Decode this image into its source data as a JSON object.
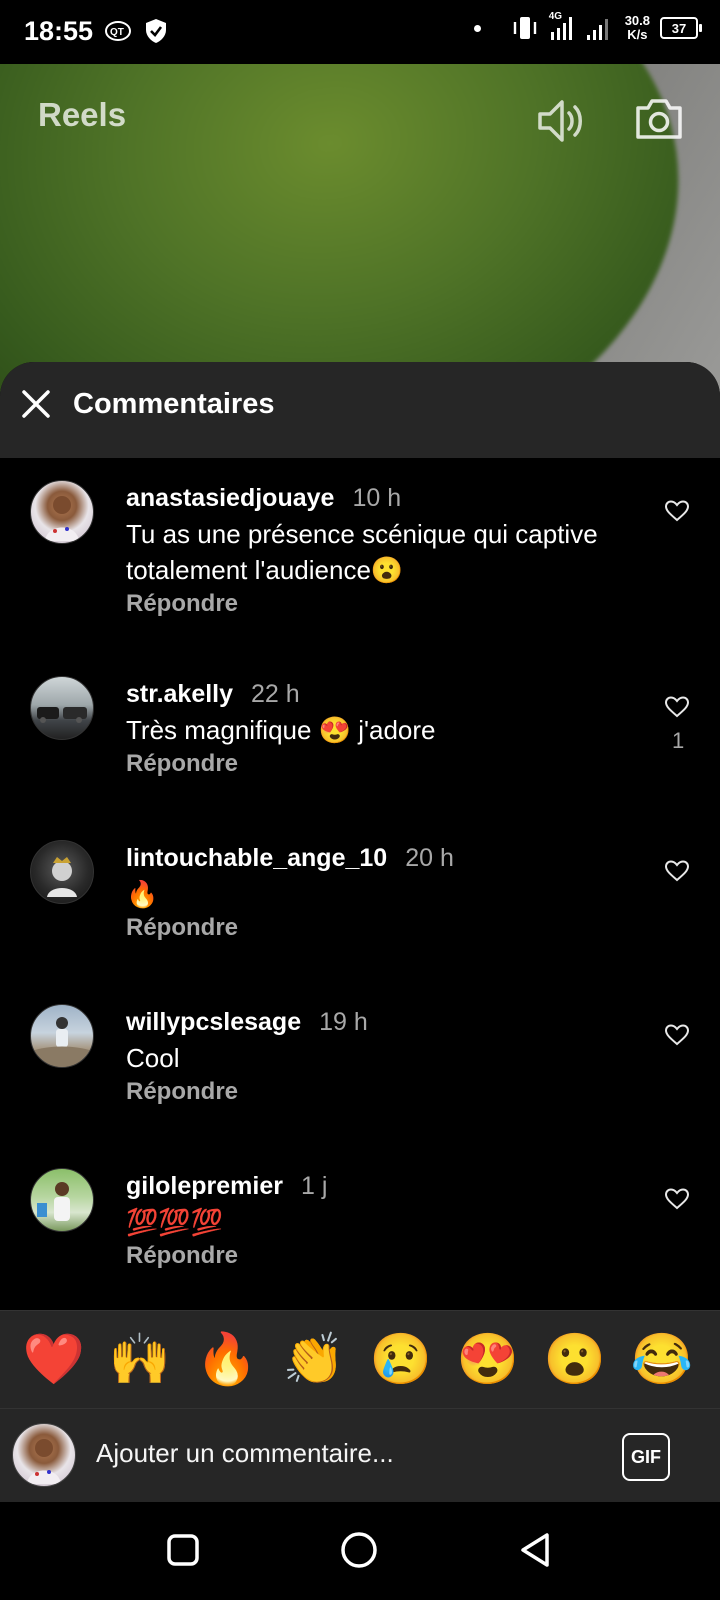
{
  "status_bar": {
    "time": "18:55",
    "network": "4G",
    "speed_value": "30.8",
    "speed_unit": "K/s",
    "battery": "37"
  },
  "video": {
    "title": "Reels"
  },
  "comments_sheet": {
    "title": "Commentaires",
    "comments": [
      {
        "user": "anastasiedjouaye",
        "time": "10 h",
        "text": "Tu as une présence scénique qui captive totalement l'audience😮",
        "reply": "Répondre",
        "likes": ""
      },
      {
        "user": "str.akelly",
        "time": "22 h",
        "text": "Très magnifique 😍 j'adore",
        "reply": "Répondre",
        "likes": "1"
      },
      {
        "user": "lintouchable_ange_10",
        "time": "20 h",
        "text": "🔥",
        "reply": "Répondre",
        "likes": ""
      },
      {
        "user": "willypcslesage",
        "time": "19 h",
        "text": "Cool",
        "reply": "Répondre",
        "likes": ""
      },
      {
        "user": "gilolepremier",
        "time": "1 j",
        "text": "💯💯💯",
        "reply": "Répondre",
        "likes": ""
      }
    ]
  },
  "emoji_bar": [
    "❤️",
    "🙌",
    "🔥",
    "👏",
    "😢",
    "😍",
    "😮",
    "😂"
  ],
  "comment_input": {
    "placeholder": "Ajouter un commentaire...",
    "gif_label": "GIF"
  }
}
